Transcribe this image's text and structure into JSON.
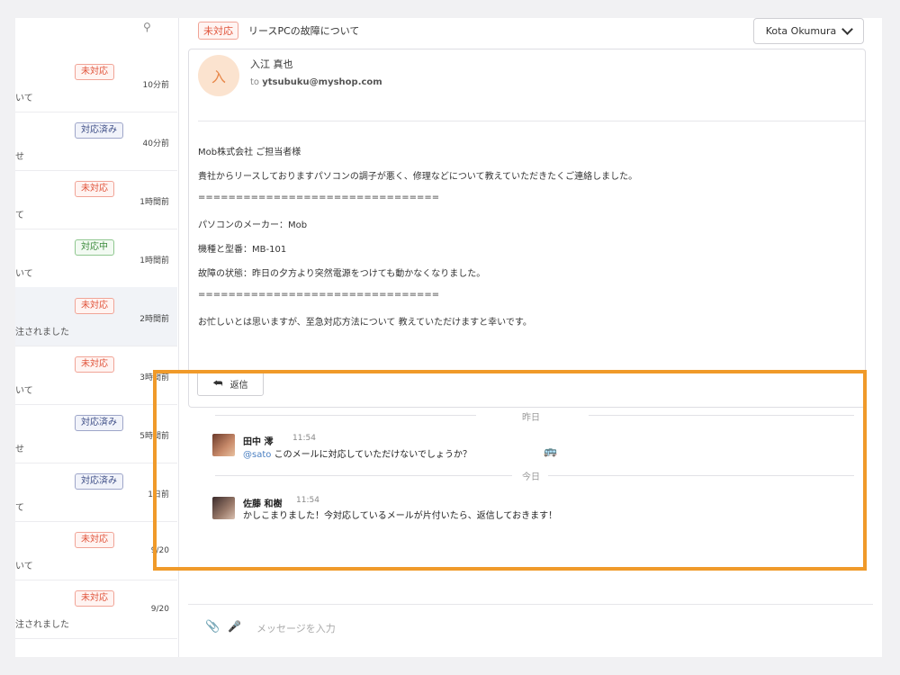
{
  "conversation_list": {
    "items": [
      {
        "status": "未対応",
        "status_type": "red",
        "time": "10分前",
        "subject": "いて"
      },
      {
        "status": "対応済み",
        "status_type": "blue",
        "time": "40分前",
        "subject": "せ"
      },
      {
        "status": "未対応",
        "status_type": "red",
        "time": "1時間前",
        "subject": "て"
      },
      {
        "status": "対応中",
        "status_type": "green",
        "time": "1時間前",
        "subject": "いて"
      },
      {
        "status": "未対応",
        "status_type": "red",
        "time": "2時間前",
        "subject": "注されました"
      },
      {
        "status": "未対応",
        "status_type": "red",
        "time": "3時間前",
        "subject": "いて"
      },
      {
        "status": "対応済み",
        "status_type": "blue",
        "time": "5時間前",
        "subject": "せ"
      },
      {
        "status": "対応済み",
        "status_type": "blue",
        "time": "1日前",
        "subject": "て"
      },
      {
        "status": "未対応",
        "status_type": "red",
        "time": "9/20",
        "subject": "いて"
      },
      {
        "status": "未対応",
        "status_type": "red",
        "time": "9/20",
        "subject": "注されました"
      }
    ]
  },
  "header": {
    "status": "未対応",
    "title": "リースPCの故障について",
    "assignee": "Kota Okumura"
  },
  "mail": {
    "avatar_char": "入",
    "sender": "入江 真也",
    "to_prefix": "to",
    "to_address": "ytsubuku@myshop.com",
    "body": [
      "Mob株式会社 ご担当者様",
      "貴社からリースしておりますパソコンの調子が悪く、修理などについて教えていただきたくご連絡しました。",
      "================================",
      "パソコンのメーカー：Mob",
      "機種と型番：MB-101",
      "故障の状態：昨日の夕方より突然電源をつけても動かなくなりました。",
      "================================",
      "お忙しいとは思いますが、至急対応方法について 教えていただけますと幸いです。"
    ],
    "reply_label": "返信"
  },
  "comments": {
    "day1": "昨日",
    "day2": "今日",
    "items": [
      {
        "name": "田中 澪",
        "time": "11:54",
        "mention": "@sato",
        "text": "このメールに対応していただけないでしょうか？"
      },
      {
        "name": "佐藤 和樹",
        "time": "11:54",
        "mention": "",
        "text": "かしこまりました！今対応しているメールが片付いたら、返信しておきます！"
      }
    ]
  },
  "composer": {
    "placeholder": "メッセージを入力"
  },
  "icons": {
    "search": "search-icon",
    "reply": "reply-arrow-icon",
    "attach": "paperclip-icon",
    "mic": "microphone-icon",
    "bus": "bus-emoji-icon"
  },
  "colors": {
    "highlight": "#f09a2a",
    "status_red": "#e0533a",
    "status_blue": "#3d4d86",
    "status_green": "#3b8a3b"
  }
}
